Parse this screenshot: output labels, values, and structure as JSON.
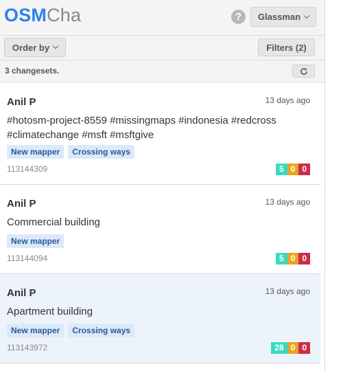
{
  "header": {
    "logo_bold": "OSM",
    "logo_light": "Cha",
    "help_label": "?",
    "user_label": "Glassman"
  },
  "toolbar": {
    "order_label": "Order by",
    "filters_label": "Filters (2)"
  },
  "summary": {
    "count_text": "3 changesets.",
    "refresh_icon": "refresh-icon"
  },
  "colors": {
    "brand": "#2f80ed",
    "tag_bg": "#dce9f9",
    "create": "#39dbc0",
    "modify": "#e8a31f",
    "delete": "#cc2c47",
    "selected_row": "#edf3fb"
  },
  "changesets": [
    {
      "user": "Anil P",
      "time": "13 days ago",
      "comment": "#hotosm-project-8559 #missingmaps #indonesia #redcross #climatechange #msft #msftgive",
      "tags": [
        "New mapper",
        "Crossing ways"
      ],
      "id": "113144309",
      "create": "5",
      "modify": "0",
      "delete": "0"
    },
    {
      "user": "Anil P",
      "time": "13 days ago",
      "comment": "Commercial building",
      "tags": [
        "New mapper"
      ],
      "id": "113144094",
      "create": "5",
      "modify": "0",
      "delete": "0"
    },
    {
      "user": "Anil P",
      "time": "13 days ago",
      "comment": "Apartment building",
      "tags": [
        "New mapper",
        "Crossing ways"
      ],
      "id": "113143972",
      "create": "28",
      "modify": "0",
      "delete": "0"
    }
  ]
}
